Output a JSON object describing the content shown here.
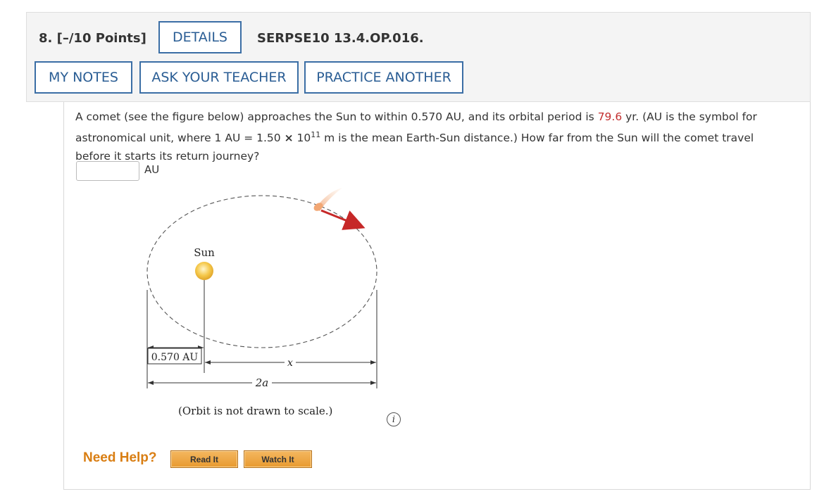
{
  "question": {
    "number_label": "8. [–/10 Points]",
    "details_label": "DETAILS",
    "id_label": "SERPSE10 13.4.OP.016.",
    "buttons": {
      "my_notes": "MY NOTES",
      "ask_teacher": "ASK YOUR TEACHER",
      "practice_another": "PRACTICE ANOTHER"
    }
  },
  "prompt": {
    "part1": "A comet (see the figure below) approaches the Sun to within 0.570 AU, and its orbital period is ",
    "period_value": "79.6",
    "part2": " yr. (AU is the symbol for astronomical unit, where 1 AU = 1.50 ",
    "times_symbol": "×",
    "power_base": " 10",
    "power_exp": "11",
    "part3": " m is the mean Earth-Sun distance.) How far from the Sun will the comet travel before it starts its return journey?"
  },
  "answer": {
    "value": "",
    "unit": "AU"
  },
  "figure": {
    "sun_label": "Sun",
    "perihelion_label": "0.570 AU",
    "x_label": "x",
    "major_axis_label": "2a",
    "caption": "(Orbit is not drawn to scale.)"
  },
  "info_icon": "i",
  "help": {
    "label": "Need Help?",
    "read_it": "Read It",
    "watch_it": "Watch It"
  },
  "colors": {
    "accent_blue": "#2a5d94",
    "highlight_red": "#c32f2f",
    "help_orange": "#d97e13",
    "sun_yellow": "#f5c84a",
    "arrow_red": "#c62828"
  }
}
